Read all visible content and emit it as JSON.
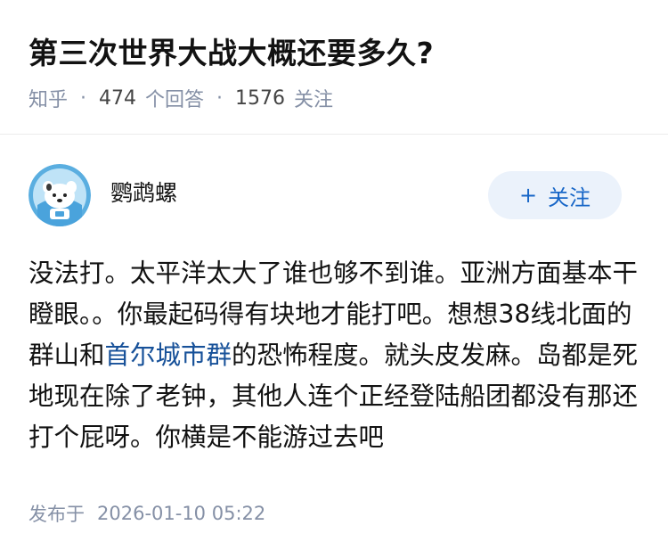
{
  "question": {
    "title": "第三次世界大战大概还要多久?",
    "source": "知乎",
    "answer_count": "474",
    "answer_label": "个回答",
    "follower_count": "1576",
    "follower_label": "关注",
    "separator": "·"
  },
  "author": {
    "name": "鹦鹉螺",
    "avatar_icon": "astronaut-bear-avatar",
    "follow_plus": "+",
    "follow_label": "关注"
  },
  "answer": {
    "text_before_link": "没法打。太平洋太大了谁也够不到谁。亚洲方面基本干瞪眼。。你最起码得有块地才能打吧。想想38线北面的群山和",
    "link_text": "首尔城市群",
    "text_after_link": "的恐怖程度。就头皮发麻。岛都是死地现在除了老钟，其他人连个正经登陆船团都没有那还打个屁呀。你横是不能游过去吧"
  },
  "footer": {
    "published_label": "发布于",
    "published_time": "2026-01-10 05:22"
  },
  "colors": {
    "link": "#175199",
    "meta_gray": "#8590a6",
    "follow_bg": "#ebf2fb",
    "follow_text": "#1766c7"
  }
}
